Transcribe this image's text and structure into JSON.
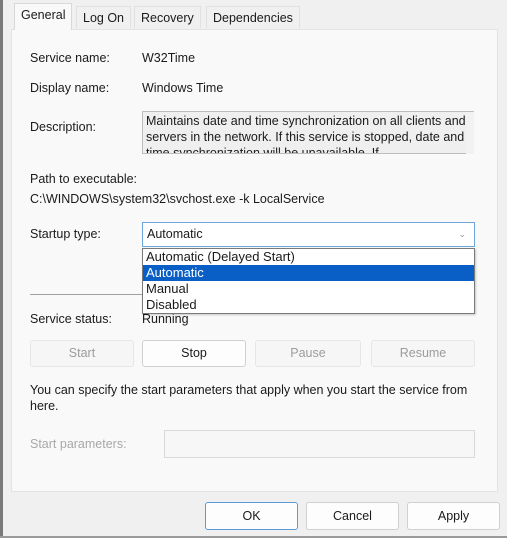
{
  "tabs": [
    "General",
    "Log On",
    "Recovery",
    "Dependencies"
  ],
  "fields": {
    "service_name_label": "Service name:",
    "service_name": "W32Time",
    "display_name_label": "Display name:",
    "display_name": "Windows Time",
    "description_label": "Description:",
    "description": "Maintains date and time synchronization on all clients and servers in the network. If this service is stopped, date and time synchronization will be unavailable. If",
    "path_label": "Path to executable:",
    "path": "C:\\WINDOWS\\system32\\svchost.exe -k LocalService",
    "startup_label": "Startup type:",
    "startup_value": "Automatic",
    "startup_options": [
      "Automatic (Delayed Start)",
      "Automatic",
      "Manual",
      "Disabled"
    ],
    "status_label": "Service status:",
    "status": "Running"
  },
  "service_buttons": [
    "Start",
    "Stop",
    "Pause",
    "Resume"
  ],
  "params_hint": "You can specify the start parameters that apply when you start the service from here.",
  "params_label": "Start parameters:",
  "params_value": "",
  "footer": {
    "ok": "OK",
    "cancel": "Cancel",
    "apply": "Apply"
  }
}
